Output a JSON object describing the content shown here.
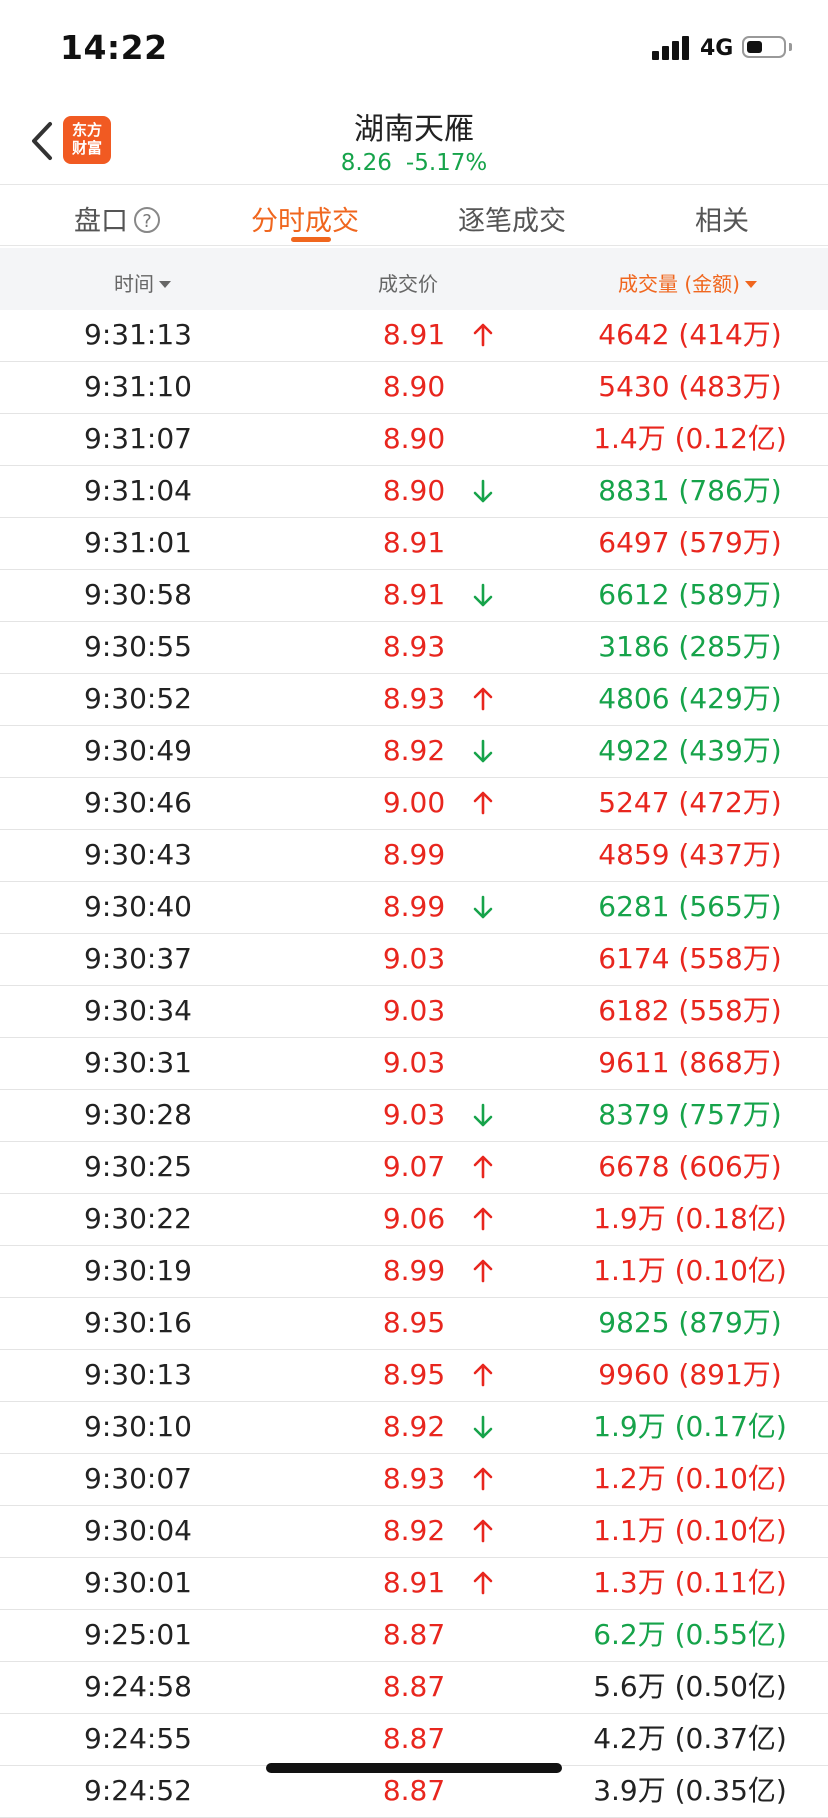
{
  "status_bar": {
    "time": "14:22",
    "network": "4G",
    "battery_level": 0.45
  },
  "header": {
    "back_icon": "chevron-left-icon",
    "logo_line1": "东方",
    "logo_line2": "财富",
    "title": "湖南天雁",
    "price": "8.26",
    "change_pct": "-5.17%",
    "price_color": "#16a34a"
  },
  "tabs": [
    {
      "label": "盘口",
      "active": false
    },
    {
      "label": "分时成交",
      "active": true
    },
    {
      "label": "逐笔成交",
      "active": false
    },
    {
      "label": "相关",
      "active": false
    }
  ],
  "help_icon_label": "?",
  "table": {
    "headers": {
      "time": "时间",
      "price": "成交价",
      "volume": "成交量 (金额)"
    },
    "rows": [
      {
        "time": "9:31:13",
        "price": "8.91",
        "arrow": "up",
        "volume": "4642 (414万)",
        "vol_color": "red"
      },
      {
        "time": "9:31:10",
        "price": "8.90",
        "arrow": "",
        "volume": "5430 (483万)",
        "vol_color": "red"
      },
      {
        "time": "9:31:07",
        "price": "8.90",
        "arrow": "",
        "volume": "1.4万 (0.12亿)",
        "vol_color": "red"
      },
      {
        "time": "9:31:04",
        "price": "8.90",
        "arrow": "down",
        "volume": "8831 (786万)",
        "vol_color": "green"
      },
      {
        "time": "9:31:01",
        "price": "8.91",
        "arrow": "",
        "volume": "6497 (579万)",
        "vol_color": "red"
      },
      {
        "time": "9:30:58",
        "price": "8.91",
        "arrow": "down",
        "volume": "6612 (589万)",
        "vol_color": "green"
      },
      {
        "time": "9:30:55",
        "price": "8.93",
        "arrow": "",
        "volume": "3186 (285万)",
        "vol_color": "green"
      },
      {
        "time": "9:30:52",
        "price": "8.93",
        "arrow": "up",
        "volume": "4806 (429万)",
        "vol_color": "green"
      },
      {
        "time": "9:30:49",
        "price": "8.92",
        "arrow": "down",
        "volume": "4922 (439万)",
        "vol_color": "green"
      },
      {
        "time": "9:30:46",
        "price": "9.00",
        "arrow": "up",
        "volume": "5247 (472万)",
        "vol_color": "red"
      },
      {
        "time": "9:30:43",
        "price": "8.99",
        "arrow": "",
        "volume": "4859 (437万)",
        "vol_color": "red"
      },
      {
        "time": "9:30:40",
        "price": "8.99",
        "arrow": "down",
        "volume": "6281 (565万)",
        "vol_color": "green"
      },
      {
        "time": "9:30:37",
        "price": "9.03",
        "arrow": "",
        "volume": "6174 (558万)",
        "vol_color": "red"
      },
      {
        "time": "9:30:34",
        "price": "9.03",
        "arrow": "",
        "volume": "6182 (558万)",
        "vol_color": "red"
      },
      {
        "time": "9:30:31",
        "price": "9.03",
        "arrow": "",
        "volume": "9611 (868万)",
        "vol_color": "red"
      },
      {
        "time": "9:30:28",
        "price": "9.03",
        "arrow": "down",
        "volume": "8379 (757万)",
        "vol_color": "green"
      },
      {
        "time": "9:30:25",
        "price": "9.07",
        "arrow": "up",
        "volume": "6678 (606万)",
        "vol_color": "red"
      },
      {
        "time": "9:30:22",
        "price": "9.06",
        "arrow": "up",
        "volume": "1.9万 (0.18亿)",
        "vol_color": "red"
      },
      {
        "time": "9:30:19",
        "price": "8.99",
        "arrow": "up",
        "volume": "1.1万 (0.10亿)",
        "vol_color": "red"
      },
      {
        "time": "9:30:16",
        "price": "8.95",
        "arrow": "",
        "volume": "9825 (879万)",
        "vol_color": "green"
      },
      {
        "time": "9:30:13",
        "price": "8.95",
        "arrow": "up",
        "volume": "9960 (891万)",
        "vol_color": "red"
      },
      {
        "time": "9:30:10",
        "price": "8.92",
        "arrow": "down",
        "volume": "1.9万 (0.17亿)",
        "vol_color": "green"
      },
      {
        "time": "9:30:07",
        "price": "8.93",
        "arrow": "up",
        "volume": "1.2万 (0.10亿)",
        "vol_color": "red"
      },
      {
        "time": "9:30:04",
        "price": "8.92",
        "arrow": "up",
        "volume": "1.1万 (0.10亿)",
        "vol_color": "red"
      },
      {
        "time": "9:30:01",
        "price": "8.91",
        "arrow": "up",
        "volume": "1.3万 (0.11亿)",
        "vol_color": "red"
      },
      {
        "time": "9:25:01",
        "price": "8.87",
        "arrow": "",
        "volume": "6.2万 (0.55亿)",
        "vol_color": "green"
      },
      {
        "time": "9:24:58",
        "price": "8.87",
        "arrow": "",
        "volume": "5.6万 (0.50亿)",
        "vol_color": "gray"
      },
      {
        "time": "9:24:55",
        "price": "8.87",
        "arrow": "",
        "volume": "4.2万 (0.37亿)",
        "vol_color": "gray"
      },
      {
        "time": "9:24:52",
        "price": "8.87",
        "arrow": "",
        "volume": "3.9万 (0.35亿)",
        "vol_color": "gray"
      }
    ]
  },
  "colors": {
    "accent": "#f0661e",
    "up": "#e8261e",
    "down": "#16a34a",
    "logo_bg": "#f15a22"
  }
}
